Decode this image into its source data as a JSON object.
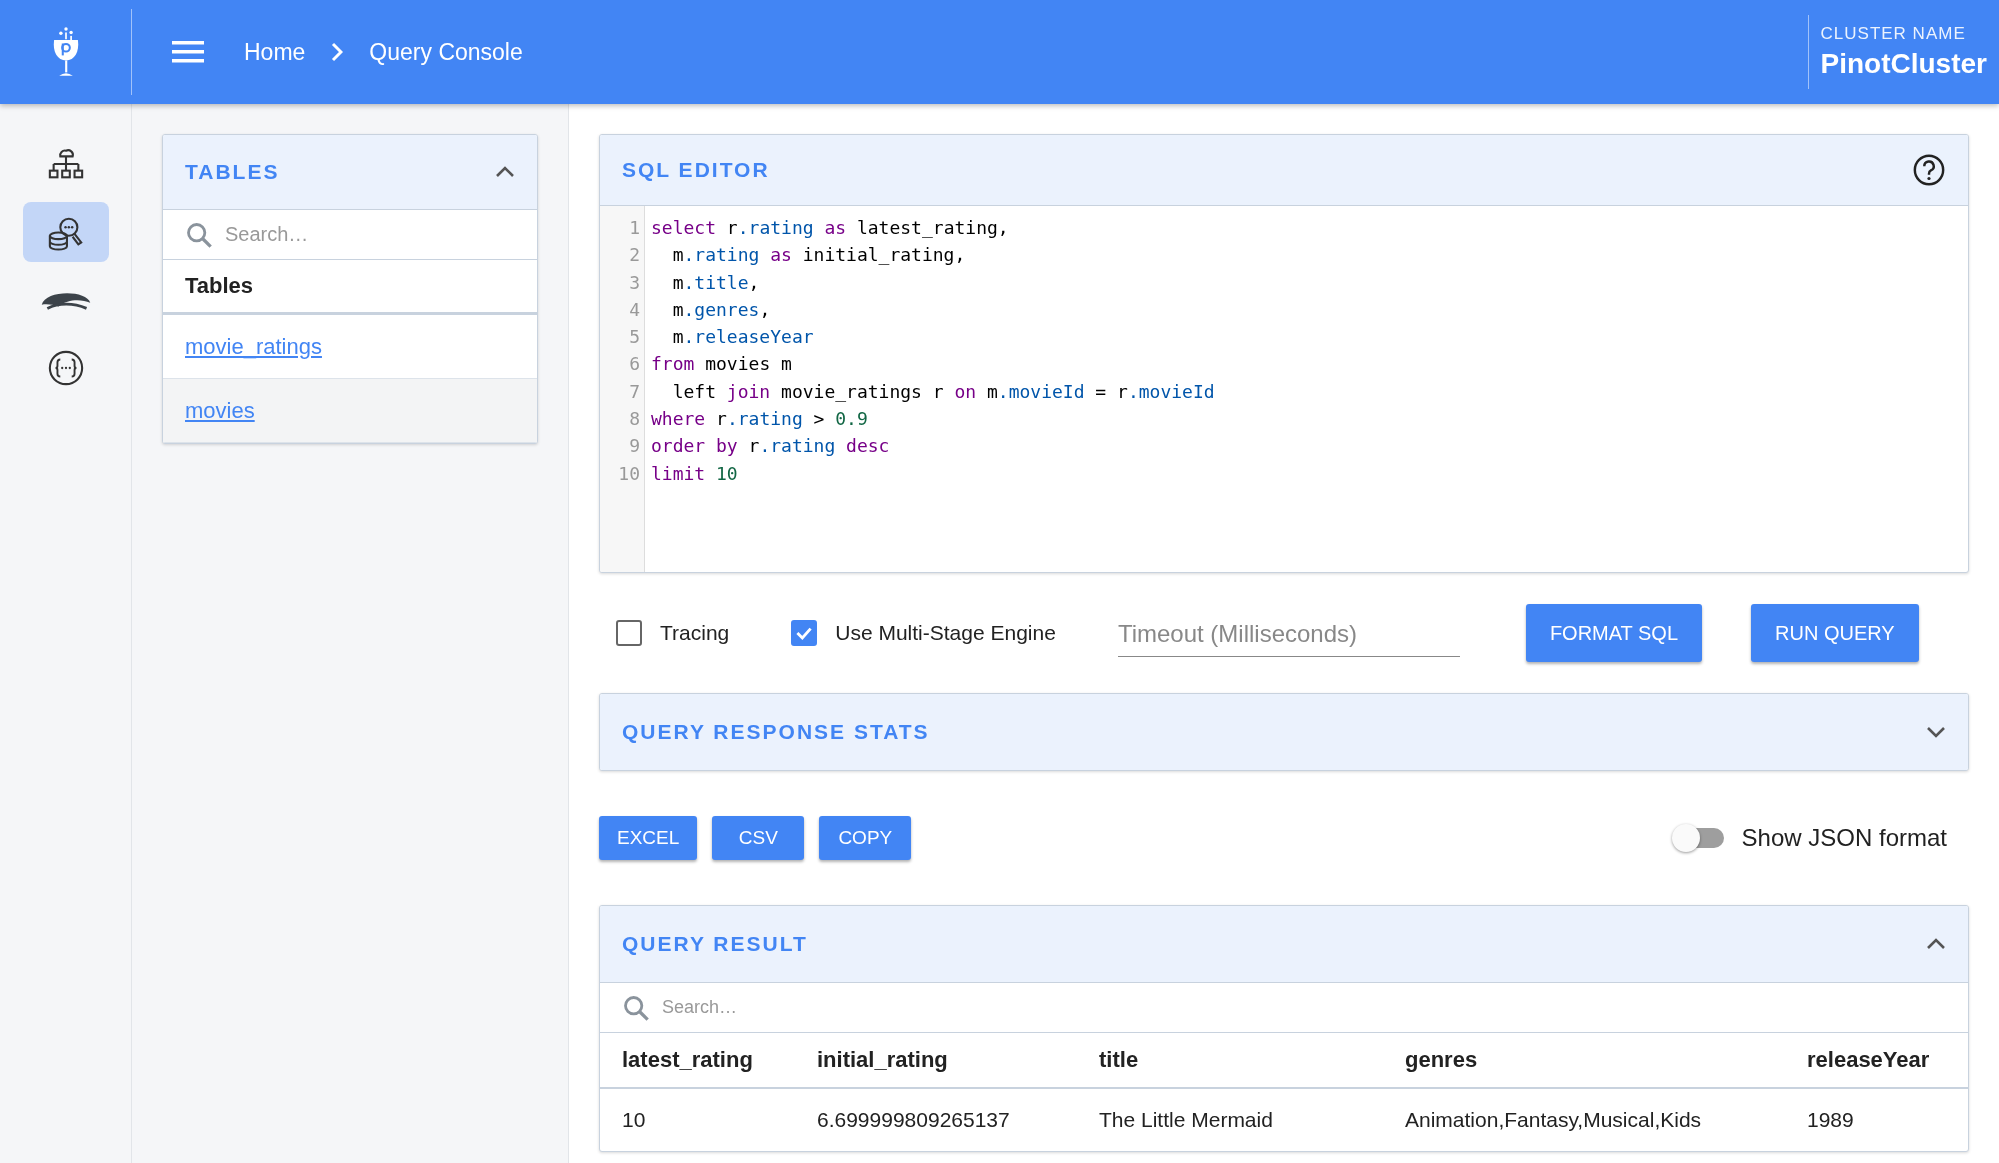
{
  "header": {
    "breadcrumb": [
      {
        "label": "Home"
      },
      {
        "label": "Query Console"
      }
    ],
    "cluster_label": "CLUSTER NAME",
    "cluster_name": "PinotCluster"
  },
  "nav": [
    {
      "kind": "cluster",
      "selected": false
    },
    {
      "kind": "query",
      "selected": true
    },
    {
      "kind": "zookeeper",
      "selected": false
    },
    {
      "kind": "api",
      "selected": false
    }
  ],
  "tables_panel": {
    "title": "TABLES",
    "expanded": true,
    "search_placeholder": "Search…",
    "column": "Tables",
    "rows": [
      {
        "name": "movie_ratings",
        "selected": false
      },
      {
        "name": "movies",
        "selected": true
      }
    ]
  },
  "sql_editor": {
    "title": "SQL EDITOR",
    "lines": [
      {
        "number": "1",
        "tokens": [
          {
            "kind": "kw",
            "text": "select"
          },
          {
            "kind": "plain",
            "text": " r"
          },
          {
            "kind": "prop",
            "text": ".rating"
          },
          {
            "kind": "kw",
            "text": " as"
          },
          {
            "kind": "plain",
            "text": " latest_rating,"
          }
        ]
      },
      {
        "number": "2",
        "tokens": [
          {
            "kind": "plain",
            "text": "  m"
          },
          {
            "kind": "prop",
            "text": ".rating"
          },
          {
            "kind": "kw",
            "text": " as"
          },
          {
            "kind": "plain",
            "text": " initial_rating,"
          }
        ]
      },
      {
        "number": "3",
        "tokens": [
          {
            "kind": "plain",
            "text": "  m"
          },
          {
            "kind": "prop",
            "text": ".title"
          },
          {
            "kind": "plain",
            "text": ","
          }
        ]
      },
      {
        "number": "4",
        "tokens": [
          {
            "kind": "plain",
            "text": "  m"
          },
          {
            "kind": "prop",
            "text": ".genres"
          },
          {
            "kind": "plain",
            "text": ","
          }
        ]
      },
      {
        "number": "5",
        "tokens": [
          {
            "kind": "plain",
            "text": "  m"
          },
          {
            "kind": "prop",
            "text": ".releaseYear"
          }
        ]
      },
      {
        "number": "6",
        "tokens": [
          {
            "kind": "kw",
            "text": "from"
          },
          {
            "kind": "plain",
            "text": " movies m"
          }
        ]
      },
      {
        "number": "7",
        "tokens": [
          {
            "kind": "plain",
            "text": "  left "
          },
          {
            "kind": "kw",
            "text": "join"
          },
          {
            "kind": "plain",
            "text": " movie_ratings r "
          },
          {
            "kind": "kw",
            "text": "on"
          },
          {
            "kind": "plain",
            "text": " m"
          },
          {
            "kind": "prop",
            "text": ".movieId"
          },
          {
            "kind": "plain",
            "text": " = r"
          },
          {
            "kind": "prop",
            "text": ".movieId"
          }
        ]
      },
      {
        "number": "8",
        "tokens": [
          {
            "kind": "kw",
            "text": "where"
          },
          {
            "kind": "plain",
            "text": " r"
          },
          {
            "kind": "prop",
            "text": ".rating"
          },
          {
            "kind": "plain",
            "text": " > "
          },
          {
            "kind": "num",
            "text": "0.9"
          }
        ]
      },
      {
        "number": "9",
        "tokens": [
          {
            "kind": "kw",
            "text": "order by"
          },
          {
            "kind": "plain",
            "text": " r"
          },
          {
            "kind": "prop",
            "text": ".rating"
          },
          {
            "kind": "kw",
            "text": " desc"
          }
        ]
      },
      {
        "number": "10",
        "tokens": [
          {
            "kind": "kw",
            "text": "limit"
          },
          {
            "kind": "num",
            "text": " 10"
          }
        ]
      }
    ]
  },
  "options": {
    "checkboxes": [
      {
        "label": "Tracing",
        "checked": false
      },
      {
        "label": "Use Multi-Stage Engine",
        "checked": true
      }
    ],
    "timeout": {
      "placeholder": "Timeout (Milliseconds)"
    },
    "buttons": [
      "FORMAT SQL",
      "RUN QUERY"
    ]
  },
  "stats_panel": {
    "title": "QUERY RESPONSE STATS",
    "expanded": false
  },
  "export_buttons": [
    "EXCEL",
    "CSV",
    "COPY"
  ],
  "json_toggle": {
    "label": "Show JSON format",
    "on": false
  },
  "result_panel": {
    "title": "QUERY RESULT",
    "expanded": true,
    "search_placeholder": "Search…",
    "columns": [
      "latest_rating",
      "initial_rating",
      "title",
      "genres",
      "releaseYear"
    ],
    "rows": [
      [
        "10",
        "6.699999809265137",
        "The Little Mermaid",
        "Animation,Fantasy,Musical,Kids",
        "1989"
      ]
    ]
  }
}
